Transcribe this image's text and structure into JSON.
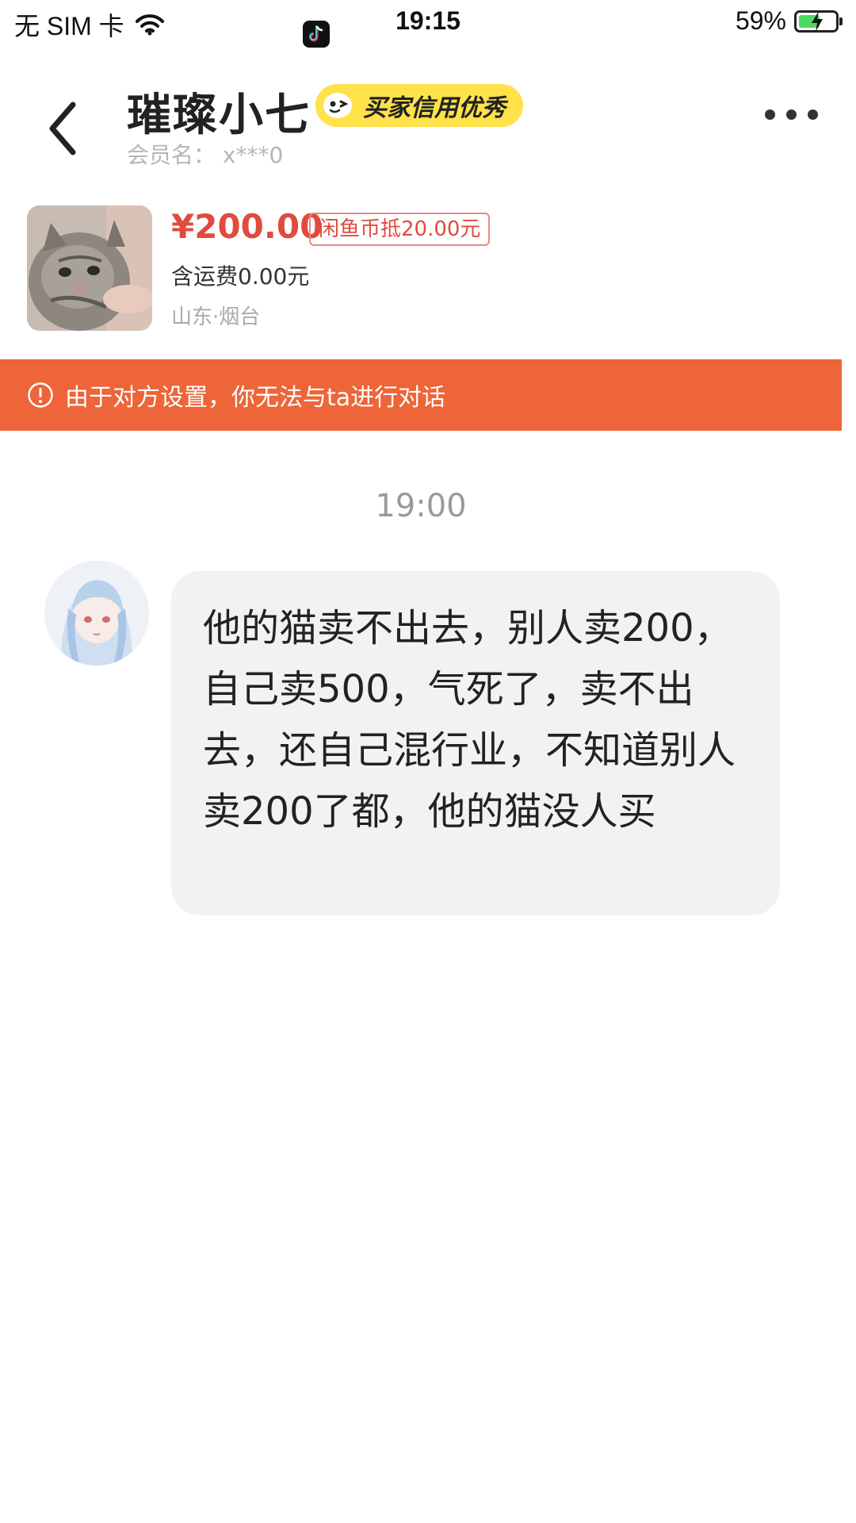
{
  "status_bar": {
    "carrier": "无 SIM 卡",
    "time": "19:15",
    "battery_percent": "59%",
    "battery_level": 0.59,
    "app_icon": "tiktok-icon",
    "wifi_icon": "wifi-icon"
  },
  "header": {
    "title": "璀璨小七",
    "credit_badge": "买家信用优秀",
    "member_name": "会员名： x***0"
  },
  "product": {
    "price": "¥200.00",
    "coin_discount": "闲鱼币抵20.00元",
    "shipping": "含运费0.00元",
    "location": "山东·烟台"
  },
  "warning": {
    "text": "由于对方设置，你无法与ta进行对话"
  },
  "chat": {
    "timestamp": "19:00",
    "messages": [
      {
        "sender": "other",
        "text": "他的猫卖不出去，别人卖200，自己卖500，气死了，卖不出去，还自己混行业，不知道别人卖200了都，他的猫没人买"
      }
    ]
  },
  "colors": {
    "accent_orange": "#ed6538",
    "price_red": "#e04b3e",
    "badge_yellow": "#ffe24a",
    "bubble_gray": "#f2f2f2",
    "battery_green": "#4cd964"
  }
}
